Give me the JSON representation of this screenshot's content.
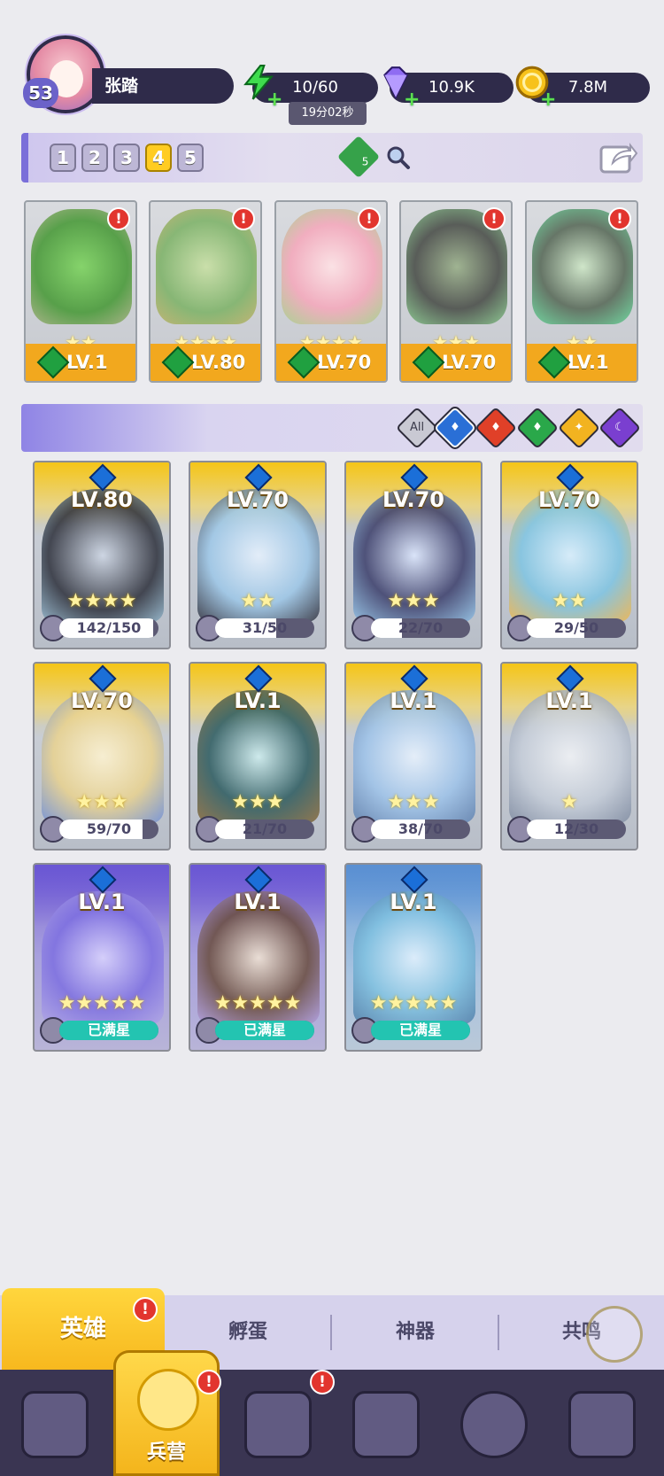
{
  "player": {
    "name": "张踏",
    "level": "53"
  },
  "resources": {
    "energy": "10/60",
    "gems": "10.9K",
    "coins": "7.8M",
    "energy_timer": "19分02秒"
  },
  "colors": {
    "accent": "#7a6fd9",
    "gold": "#f2a81e",
    "alert": "#e2352e"
  },
  "team_tabs": [
    "1",
    "2",
    "3",
    "4",
    "5"
  ],
  "team_active": "4",
  "team_gem_count": "5",
  "team": [
    {
      "level": "LV.1",
      "stars": "★★"
    },
    {
      "level": "LV.80",
      "stars": "★★★★"
    },
    {
      "level": "LV.70",
      "stars": "★★★★"
    },
    {
      "level": "LV.70",
      "stars": "★★★"
    },
    {
      "level": "LV.1",
      "stars": "★★"
    }
  ],
  "filters": {
    "all": "All"
  },
  "heroes": [
    {
      "level": "LV.80",
      "stars": "★★★★",
      "progress": "142/150",
      "fraction": 0.947
    },
    {
      "level": "LV.70",
      "stars": "★★",
      "progress": "31/50",
      "fraction": 0.62
    },
    {
      "level": "LV.70",
      "stars": "★★★",
      "progress": "22/70",
      "fraction": 0.314
    },
    {
      "level": "LV.70",
      "stars": "★★",
      "progress": "29/50",
      "fraction": 0.58
    },
    {
      "level": "LV.70",
      "stars": "★★★",
      "progress": "59/70",
      "fraction": 0.843
    },
    {
      "level": "LV.1",
      "stars": "★★★",
      "progress": "21/70",
      "fraction": 0.3
    },
    {
      "level": "LV.1",
      "stars": "★★★",
      "progress": "38/70",
      "fraction": 0.543
    },
    {
      "level": "LV.1",
      "stars": "★",
      "progress": "12/30",
      "fraction": 0.4
    },
    {
      "level": "LV.1",
      "stars": "★★★★★",
      "progress": "已满星",
      "fraction": 1
    },
    {
      "level": "LV.1",
      "stars": "★★★★★",
      "progress": "已满星",
      "fraction": 1
    },
    {
      "level": "LV.1",
      "stars": "★★★★★",
      "progress": "已满星",
      "fraction": 1
    }
  ],
  "subtabs": {
    "hero": "英雄",
    "hatch": "孵蛋",
    "artifact": "神器",
    "resonance": "共鸣"
  },
  "nav": {
    "barracks": "兵营"
  },
  "alert_mark": "!"
}
